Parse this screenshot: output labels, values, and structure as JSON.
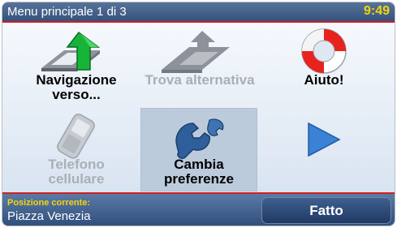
{
  "header": {
    "title": "Menu principale 1 di 3",
    "time": "9:49"
  },
  "tiles": [
    {
      "label": "Navigazione verso...",
      "icon": "navigate-arrow-icon",
      "enabled": true
    },
    {
      "label": "Trova alternativa",
      "icon": "alternative-route-icon",
      "enabled": false
    },
    {
      "label": "Aiuto!",
      "icon": "lifebuoy-icon",
      "enabled": true
    },
    {
      "label": "Telefono cellulare",
      "icon": "mobile-phone-icon",
      "enabled": false
    },
    {
      "label": "Cambia preferenze",
      "icon": "wrench-icon",
      "enabled": true,
      "selected": true
    },
    {
      "label": "",
      "icon": "next-page-arrow-icon",
      "enabled": true
    }
  ],
  "footer": {
    "position_label": "Posizione corrente:",
    "position_value": "Piazza Venezia",
    "done_label": "Fatto"
  },
  "colors": {
    "header_bg": "#3f5f8a",
    "accent_red": "#d12020",
    "clock_yellow": "#f2d60c",
    "nav_arrow_green": "#18b43a",
    "disabled_text": "#a9afb6"
  }
}
